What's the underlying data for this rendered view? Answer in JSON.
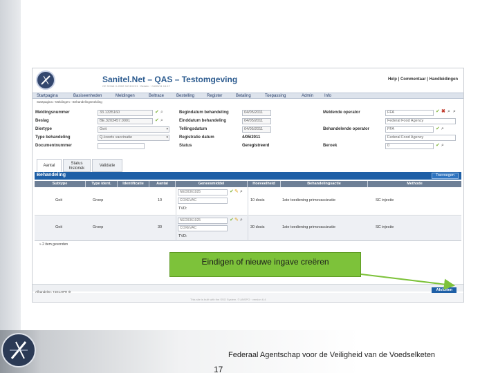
{
  "slide": {
    "footer_text": "Federaal Agentschap voor de Veiligheid van de Voedselketen",
    "page_number": "17",
    "callout_text": "Eindigen of nieuwe ingave creëren",
    "logo_icon": "afsca-logo-icon"
  },
  "app": {
    "title": "Sanitel.Net – QAS – Testomgeving",
    "subtitle": "CE SOA6 X-2002 9474XXX1 · Betaler · 04/05/11 16:17",
    "help_links": "Help | Commentaar | Handleidingen",
    "menu": [
      "Startpagina",
      "Basiseenheden",
      "Meldingen",
      "Beltrace",
      "Bestelling",
      "Register",
      "Betaling",
      "Toepassing",
      "Admin",
      "Info"
    ],
    "breadcrumb": "Startpagina › Meldingen › Behandelingsmelding",
    "form": {
      "left": [
        {
          "label": "Meldingsnummer",
          "value": "33.1335160"
        },
        {
          "label": "Beslag",
          "value": "BE.3203457.0001"
        },
        {
          "label": "Diertype",
          "value": "Geit"
        },
        {
          "label": "Type behandeling",
          "value": "Q-koorts vaccinatie"
        },
        {
          "label": "Documentnummer",
          "value": ""
        }
      ],
      "middle": [
        {
          "label": "Begindatum behandeling",
          "value": "04/05/2011"
        },
        {
          "label": "Einddatum behandeling",
          "value": "04/05/2011"
        },
        {
          "label": "Tellingsdatum",
          "value": "04/05/2011"
        },
        {
          "label": "Registratie datum",
          "value": "4/05/2011"
        },
        {
          "label": "Status",
          "value": "Geregistreerd"
        }
      ],
      "right": [
        {
          "label": "Meldende operator",
          "value": "FFA"
        },
        {
          "label": "",
          "value": "Federal Food Agency"
        },
        {
          "label": "Behandelende operator",
          "value": "FFA"
        },
        {
          "label": "",
          "value": "Federal Food Agency"
        },
        {
          "label": "Beroek",
          "value": "0"
        }
      ]
    },
    "tabs": [
      "Aantal",
      "Status historiek",
      "Validatie"
    ],
    "section": {
      "title": "Behandeling",
      "add_button": "Toevoegen"
    },
    "table": {
      "headers": [
        "Subtype",
        "Type ident.",
        "Identificatie",
        "Aantal",
        "Geneesmiddel",
        "Hoeveelheid",
        "Behandelingsactie",
        "Methode"
      ],
      "rows": [
        {
          "subtype": "Geit",
          "type_ident": "Groep",
          "identificatie": "",
          "aantal": "10",
          "geneesmiddel_code": "NED0361925",
          "geneesmiddel_name": "COXEVAC",
          "tvd": "TVD:",
          "hoeveelheid": "10 dosis",
          "actie": "1ste toediening primovaccinatie",
          "methode": "SC injectie"
        },
        {
          "subtype": "Geit",
          "type_ident": "Groep",
          "identificatie": "",
          "aantal": "30",
          "geneesmiddel_code": "NED0361925",
          "geneesmiddel_name": "COXEVAC",
          "tvd": "TVD:",
          "hoeveelheid": "30 dosis",
          "actie": "1ste toediening primovaccinatie",
          "methode": "SC injectie"
        }
      ],
      "items_found": "» 2 item gevonden"
    },
    "afhandelen": "Afhandelen: T3KCHPR  ⚙",
    "close_button": "Afsluiten",
    "footnote": "This site is built with the SSO System. © ANSPO · version 6.4"
  }
}
